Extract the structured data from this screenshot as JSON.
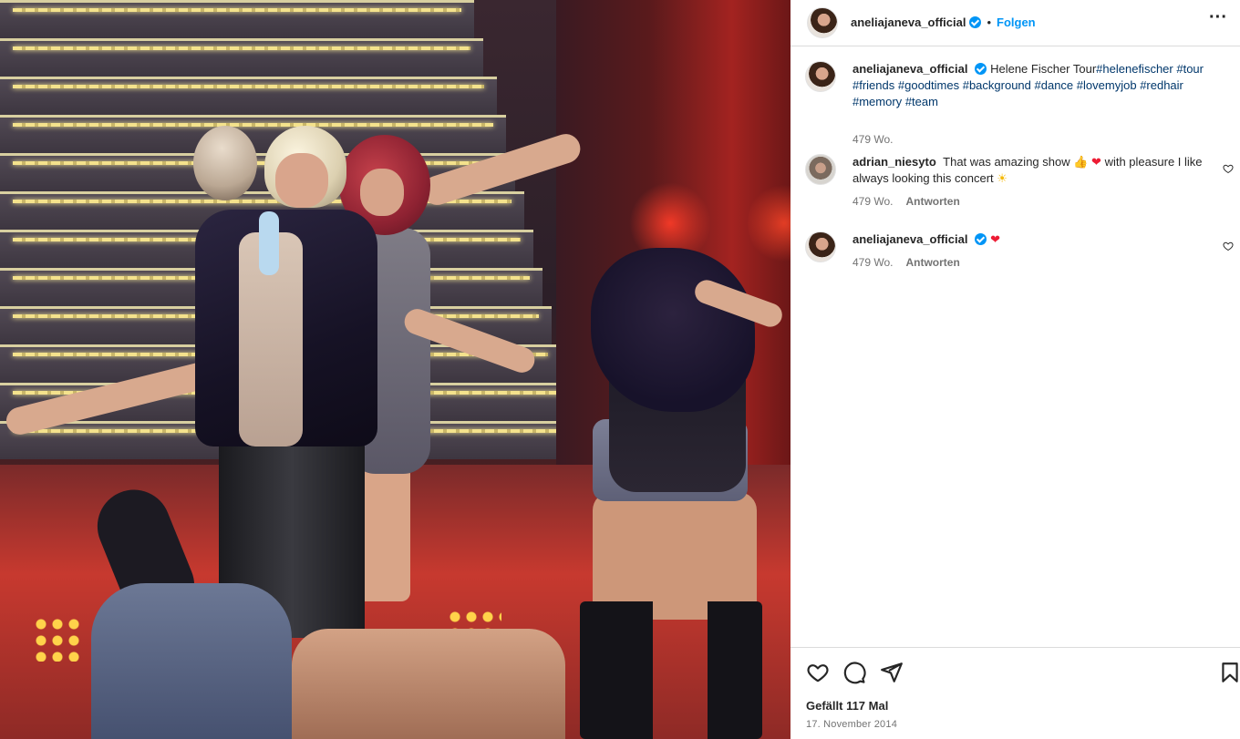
{
  "post": {
    "author": "aneliajaneva_official",
    "separator": "•",
    "follow_label": "Folgen",
    "more_label": "···"
  },
  "caption": {
    "username": "aneliajaneva_official",
    "text": "Helene Fischer Tour",
    "tags": [
      "#helenefischer",
      "#tour",
      "#friends",
      "#goodtimes",
      "#background",
      "#dance",
      "#lovemyjob",
      "#redhair",
      "#memory",
      "#team"
    ],
    "age": "479 Wo."
  },
  "comments": [
    {
      "username": "adrian_niesyto",
      "text_a": "That was amazing show",
      "emoji_thumb": "👍",
      "emoji_heart": "❤",
      "text_b": "with pleasure I like always looking this concert",
      "emoji_sun": "☀",
      "age": "479 Wo.",
      "reply_label": "Antworten"
    },
    {
      "username": "aneliajaneva_official",
      "emoji_heart": "❤",
      "age": "479 Wo.",
      "reply_label": "Antworten"
    }
  ],
  "actions": {
    "like_icon": "heart-icon",
    "comment_icon": "comment-icon",
    "share_icon": "share-icon",
    "save_icon": "bookmark-icon"
  },
  "likes_label": "Gefällt 117 Mal",
  "date_label": "17. November 2014",
  "colors": {
    "link": "#00376b",
    "follow": "#0095f6",
    "verified": "#0095f6",
    "muted": "#737373",
    "heart": "#ed1c34"
  }
}
